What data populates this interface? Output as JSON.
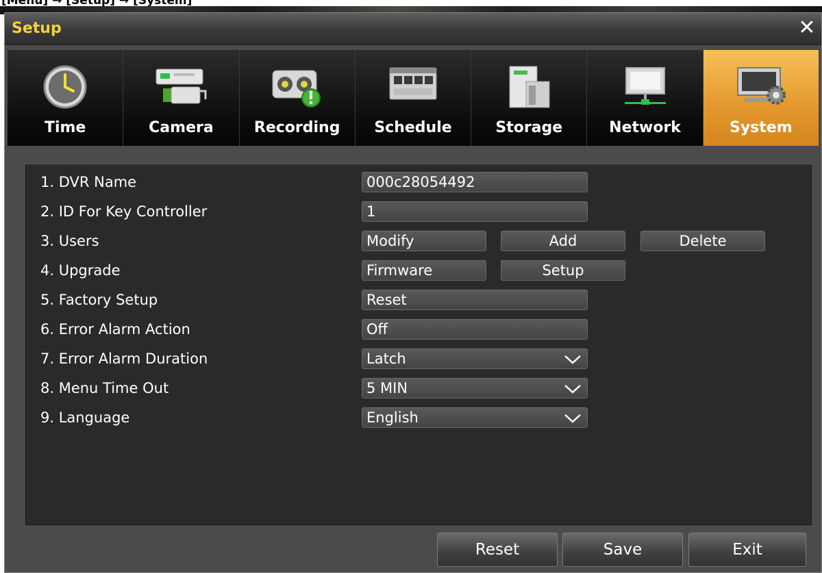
{
  "breadcrumb": "[Menu] → [Setup] → [System]",
  "window": {
    "title": "Setup",
    "close_glyph": "✕"
  },
  "tabs": [
    {
      "label": "Time",
      "icon": "clock-icon",
      "active": false
    },
    {
      "label": "Camera",
      "icon": "camera-icon",
      "active": false
    },
    {
      "label": "Recording",
      "icon": "recording-icon",
      "active": false
    },
    {
      "label": "Schedule",
      "icon": "schedule-icon",
      "active": false
    },
    {
      "label": "Storage",
      "icon": "storage-icon",
      "active": false
    },
    {
      "label": "Network",
      "icon": "network-icon",
      "active": false
    },
    {
      "label": "System",
      "icon": "system-icon",
      "active": true
    }
  ],
  "settings": {
    "rows": [
      {
        "label": "1. DVR Name"
      },
      {
        "label": "2. ID For Key Controller"
      },
      {
        "label": "3. Users"
      },
      {
        "label": "4. Upgrade"
      },
      {
        "label": "5. Factory Setup"
      },
      {
        "label": "6. Error Alarm Action"
      },
      {
        "label": "7. Error Alarm Duration"
      },
      {
        "label": "8. Menu Time Out"
      },
      {
        "label": "9. Language"
      }
    ],
    "dvr_name": "000c28054492",
    "key_controller_id": "1",
    "users_modify": "Modify",
    "users_add": "Add",
    "users_delete": "Delete",
    "upgrade_firmware": "Firmware",
    "upgrade_setup": "Setup",
    "factory_reset": "Reset",
    "error_alarm_action": "Off",
    "error_alarm_duration": "Latch",
    "menu_time_out": "5 MIN",
    "language": "English"
  },
  "footer": {
    "reset": "Reset",
    "save": "Save",
    "exit": "Exit"
  },
  "colors": {
    "accent": "#e8a03a",
    "title": "#f6d13a",
    "panel": "#2a2a2a"
  }
}
